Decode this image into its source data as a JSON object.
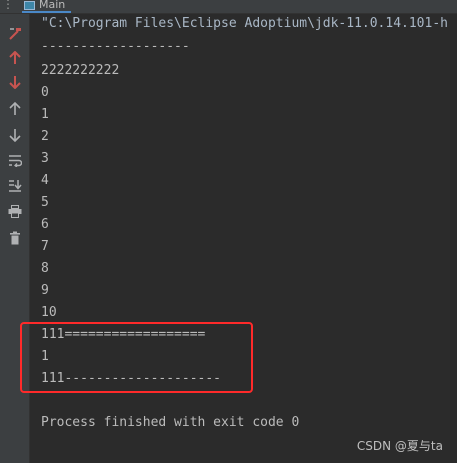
{
  "tab": {
    "more_icon": "vertical-dots-icon",
    "label": "Main"
  },
  "toolbar": {
    "items": [
      {
        "name": "rerun-icon",
        "color": "#c75450"
      },
      {
        "name": "scroll-up-red-icon",
        "color": "#c75450"
      },
      {
        "name": "scroll-down-red-icon",
        "color": "#c75450"
      },
      {
        "name": "up-arrow-icon",
        "color": "#afb1b3"
      },
      {
        "name": "down-arrow-icon",
        "color": "#afb1b3"
      },
      {
        "name": "soft-wrap-icon",
        "color": "#afb1b3"
      },
      {
        "name": "scroll-to-end-icon",
        "color": "#afb1b3"
      },
      {
        "name": "print-icon",
        "color": "#afb1b3"
      },
      {
        "name": "trash-icon",
        "color": "#afb1b3"
      }
    ]
  },
  "console": {
    "lines": [
      "\"C:\\Program Files\\Eclipse Adoptium\\jdk-11.0.14.101-h",
      "-------------------",
      "2222222222",
      "0",
      "1",
      "2",
      "3",
      "4",
      "5",
      "6",
      "7",
      "8",
      "9",
      "10",
      "111==================",
      "1",
      "111--------------------",
      "",
      "Process finished with exit code 0"
    ]
  },
  "watermark": "CSDN @夏与ta",
  "colors": {
    "background": "#2b2b2b",
    "gutter": "#3c3f41",
    "text": "#bbbbbb",
    "highlight_border": "#ff2a2a"
  }
}
